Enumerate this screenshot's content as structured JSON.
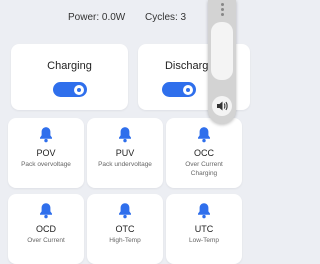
{
  "stats": {
    "power": "Power: 0.0W",
    "cycles": "Cycles: 3"
  },
  "controls": {
    "charging": {
      "label": "Charging",
      "enabled": true
    },
    "discharging": {
      "label": "Discharging",
      "enabled": true
    }
  },
  "colors": {
    "accent": "#2f6fec",
    "background": "#eceef3",
    "card": "#ffffff"
  },
  "alarms": [
    {
      "code": "POV",
      "desc": "Pack overvoltage",
      "icon": "bell-icon"
    },
    {
      "code": "PUV",
      "desc": "Pack undervoltage",
      "icon": "bell-icon"
    },
    {
      "code": "OCC",
      "desc": "Over Current Charging",
      "icon": "bell-icon"
    },
    {
      "code": "OCD",
      "desc": "Over Current",
      "icon": "bell-icon"
    },
    {
      "code": "OTC",
      "desc": "High-Temp",
      "icon": "bell-icon"
    },
    {
      "code": "UTC",
      "desc": "Low-Temp",
      "icon": "bell-icon"
    }
  ],
  "side_panel": {
    "icon": "sound-icon"
  }
}
